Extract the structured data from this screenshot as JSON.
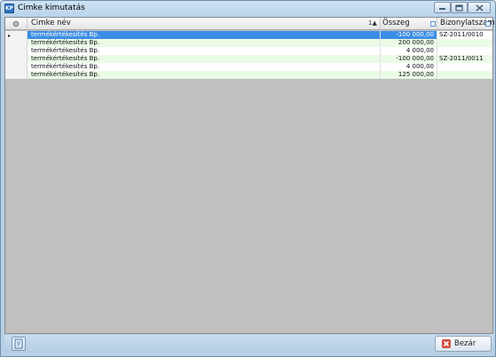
{
  "window": {
    "title": "Cimke kimutatás",
    "icon_name": "app-icon",
    "controls": [
      "minimize-icon",
      "maximize-icon",
      "close-icon"
    ]
  },
  "grid": {
    "columns": {
      "name": "Cimke név",
      "sum": "Összeg",
      "doc": "Bizonylatszám"
    },
    "sort_indicator": "1▲",
    "selection_color": "#3b8ee5",
    "alt_row_color": "#eafbe6",
    "rows": [
      {
        "name": "termékértékesítés Bp.",
        "sum": "-100 000,00",
        "doc": "SZ-2011/0010"
      },
      {
        "name": "termékértékesítés Bp.",
        "sum": "200 000,00",
        "doc": ""
      },
      {
        "name": "termékértékesítés Bp.",
        "sum": "4 000,00",
        "doc": ""
      },
      {
        "name": "termékértékesítés Bp.",
        "sum": "-100 000,00",
        "doc": "SZ-2011/0011"
      },
      {
        "name": "termékértékesítés Bp.",
        "sum": "4 000,00",
        "doc": ""
      },
      {
        "name": "termékértékesítés Bp.",
        "sum": "125 000,00",
        "doc": ""
      }
    ]
  },
  "footer": {
    "export_icon": "document-icon",
    "close_label": "Bezár"
  }
}
